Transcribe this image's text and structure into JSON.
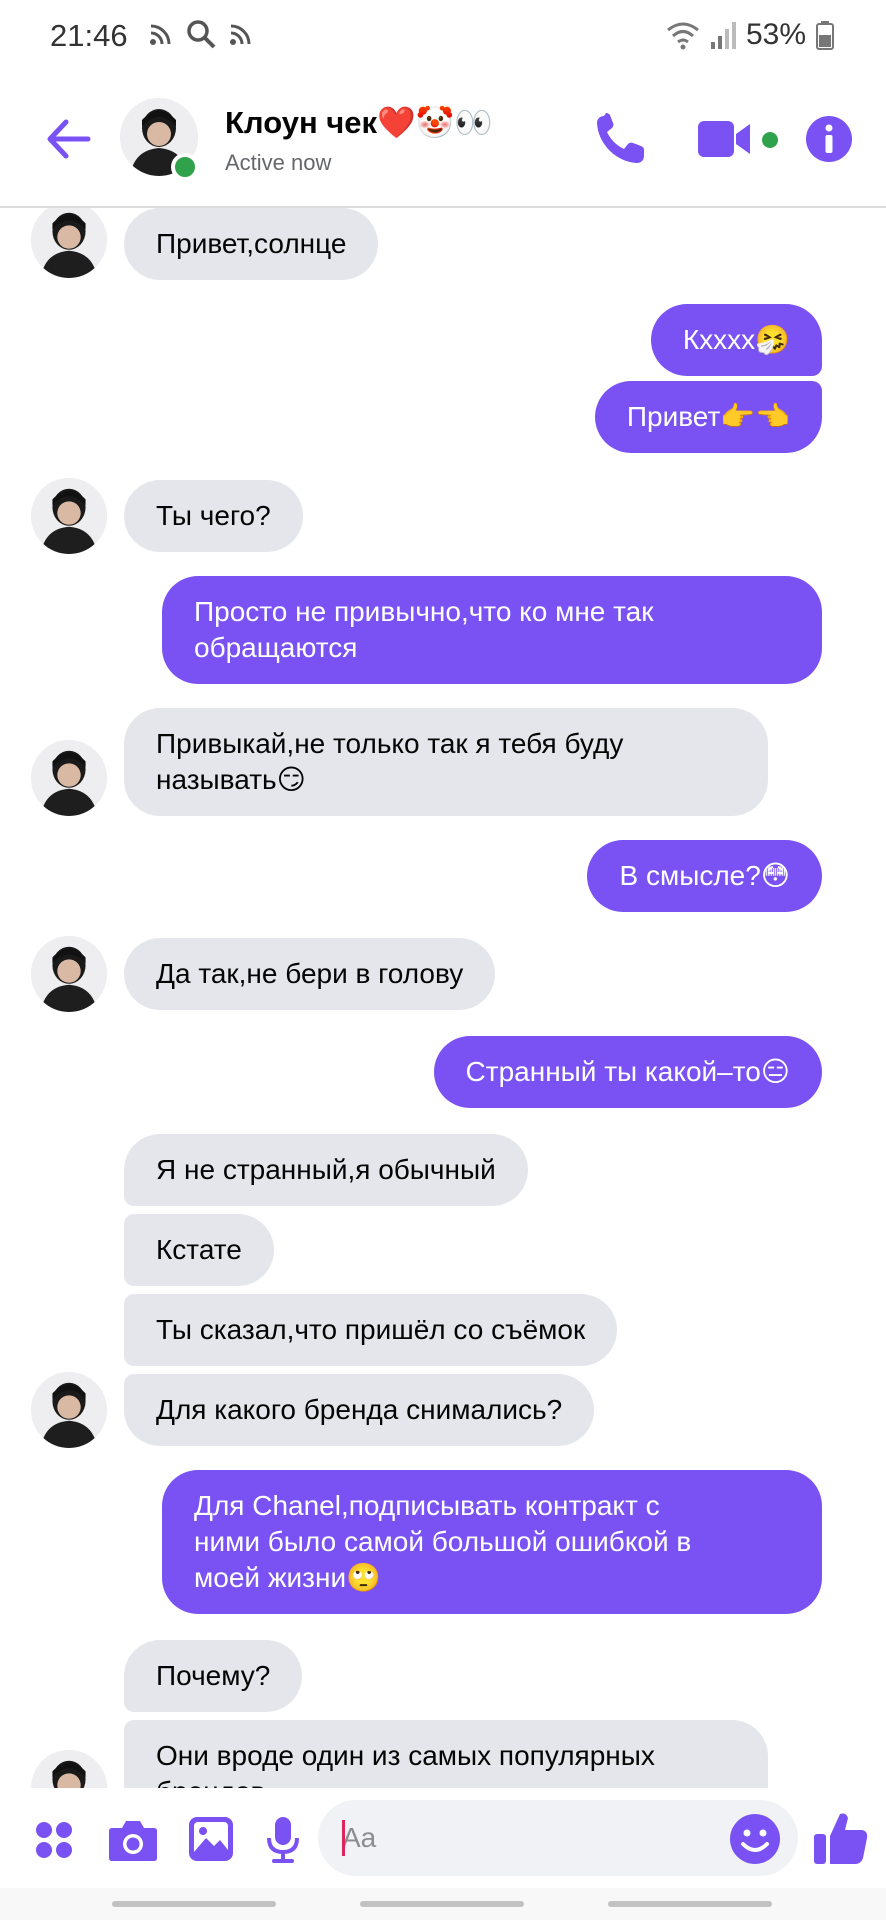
{
  "status_bar": {
    "time": "21:46",
    "battery": "53%",
    "icons": [
      "cast-icon",
      "search-icon",
      "cast-icon",
      "wifi-icon",
      "signal-icon",
      "battery-icon"
    ]
  },
  "header": {
    "contact_name": "Клоун чек❤️🤡👀",
    "status": "Active now",
    "accent_color": "#7a52f4",
    "online_color": "#31a24c"
  },
  "messages": [
    {
      "sender": "them",
      "text": "Привет,солнце"
    },
    {
      "sender": "me",
      "text": "Кхххх🤧"
    },
    {
      "sender": "me",
      "text": "Привет👉👈"
    },
    {
      "sender": "them",
      "text": "Ты чего?"
    },
    {
      "sender": "me",
      "text": "Просто не привычно,что ко мне так\nобращаются"
    },
    {
      "sender": "them",
      "text": "Привыкай,не только так я тебя буду\nназывать😏"
    },
    {
      "sender": "me",
      "text": "В смысле?😳"
    },
    {
      "sender": "them",
      "text": "Да так,не бери в голову"
    },
    {
      "sender": "me",
      "text": "Странный ты какой–то😑"
    },
    {
      "sender": "them",
      "text": "Я не странный,я обычный"
    },
    {
      "sender": "them",
      "text": "Кстате"
    },
    {
      "sender": "them",
      "text": "Ты сказал,что пришёл со съёмок"
    },
    {
      "sender": "them",
      "text": "Для какого бренда снимались?"
    },
    {
      "sender": "me",
      "text": "Для Chanel,подписывать контракт с\nними было самой большой ошибкой в\nмоей жизни🙄"
    },
    {
      "sender": "them",
      "text": "Почему?"
    },
    {
      "sender": "them",
      "text": "Они вроде один из самых популярных\nбрендов"
    }
  ],
  "composer": {
    "placeholder": "Aa",
    "icons": [
      "apps-icon",
      "camera-icon",
      "gallery-icon",
      "microphone-icon",
      "emoji-icon",
      "thumbs-up-icon"
    ]
  },
  "colors": {
    "outgoing_bubble": "#7a52f4",
    "incoming_bubble": "#e4e6eb"
  }
}
